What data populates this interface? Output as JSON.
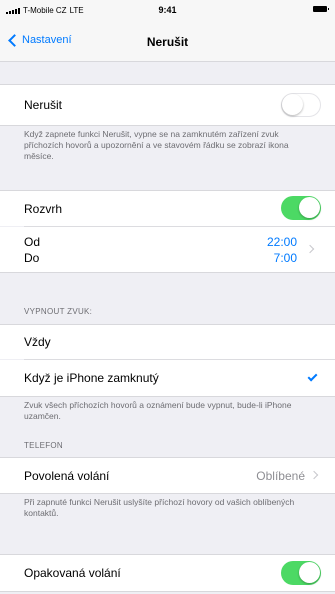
{
  "status_bar": {
    "carrier": "T-Mobile CZ",
    "network": "LTE",
    "time": "9:41"
  },
  "nav": {
    "back_label": "Nastavení",
    "title": "Nerušit"
  },
  "dnd": {
    "label": "Nerušit",
    "enabled": false,
    "footnote": "Když zapnete funkci Nerušit, vypne se na zamknutém zařízení zvuk příchozích hovorů a upozornění a ve stavovém řádku se zobrazí ikona měsíce."
  },
  "schedule": {
    "label": "Rozvrh",
    "enabled": true,
    "from_label": "Od",
    "to_label": "Do",
    "from_time": "22:00",
    "to_time": "7:00"
  },
  "silence": {
    "header": "VYPNOUT ZVUK:",
    "options": [
      {
        "label": "Vždy",
        "selected": false
      },
      {
        "label": "Když je iPhone zamknutý",
        "selected": true
      }
    ],
    "footnote": "Zvuk všech příchozích hovorů a oznámení bude vypnut, bude-li iPhone uzamčen."
  },
  "phone": {
    "header": "TELEFON",
    "allow_calls_label": "Povolená volání",
    "allow_calls_value": "Oblíbené",
    "allow_calls_footnote": "Při zapnuté funkci Nerušit uslyšíte příchozí hovory od vašich oblíbených kontaktů.",
    "repeated_calls_label": "Opakovaná volání",
    "repeated_calls_enabled": true
  },
  "colors": {
    "accent": "#007aff",
    "toggle_on": "#4cd964",
    "background": "#efeff4"
  }
}
